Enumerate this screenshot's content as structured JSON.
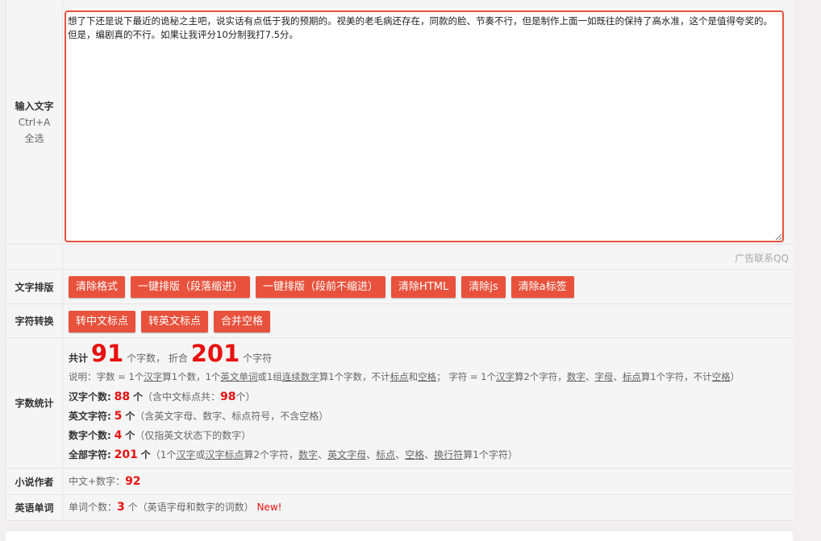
{
  "input": {
    "label": "输入文字",
    "hint": "Ctrl+A 全选",
    "text": "想了下还是说下最近的诡秘之主吧，说实话有点低于我的预期的。视美的老毛病还存在，同款的脸、节奏不行，但是制作上面一如既往的保持了高水准，这个是值得夸奖的。但是，编剧真的不行。如果让我评分10分制我打7.5分。",
    "ad": "广告联系QQ"
  },
  "layout_row": {
    "label": "文字排版",
    "buttons": [
      "清除格式",
      "一键排版（段落缩进）",
      "一键排版（段前不缩进）",
      "清除HTML",
      "清除js",
      "清除a标签"
    ]
  },
  "convert_row": {
    "label": "字符转换",
    "buttons": [
      "转中文标点",
      "转英文标点",
      "合并空格"
    ]
  },
  "stats": {
    "label": "字数统计",
    "total_prefix": "共计",
    "word_count": "91",
    "word_unit": "个字数，",
    "equiv": "折合",
    "char_count": "201",
    "char_unit": "个字符",
    "desc": {
      "p1": "说明：字数 = 1个",
      "u1": "汉字",
      "p2": "算1个数，1个",
      "u2": "英文单词",
      "p3": "或1组",
      "u3": "连续数字",
      "p4": "算1个字数，不计",
      "u4": "标点",
      "p5": "和",
      "u5": "空格",
      "p6": "；  字符 = 1个",
      "u6": "汉字",
      "p7": "算2个字符，",
      "u7": "数字",
      "p8": "、",
      "u8": "字母",
      "p9": "、",
      "u9": "标点",
      "p10": "算1个字符，不计",
      "u10": "空格",
      "p11": "）"
    },
    "hanzi_label": "汉字个数:",
    "hanzi_count": "88",
    "hanzi_unit": "个",
    "hanzi_note_a": "（含中文标点共：",
    "hanzi_punct": "98",
    "hanzi_note_b": "个）",
    "en_label": "英文字符:",
    "en_count": "5",
    "en_unit": "个",
    "en_note": "（含英文字母、数字、标点符号，不含空格）",
    "num_label": "数字个数:",
    "num_count": "4",
    "num_unit": "个",
    "num_note": "（仅指英文状态下的数字）",
    "all_label": "全部字符:",
    "all_count": "201",
    "all_unit": "个",
    "all_note": {
      "p1": "（1个",
      "u1": "汉字",
      "p2": "或",
      "u2": "汉字标点",
      "p3": "算2个字符，",
      "u3": "数字",
      "p4": "、",
      "u4": "英文字母",
      "p5": "、",
      "u5": "标点",
      "p6": "、",
      "u6": "空格",
      "p7": "、",
      "u7": "换行符",
      "p8": "算1个字符）"
    }
  },
  "novel": {
    "label": "小说作者",
    "text": "中文+数字：",
    "value": "92"
  },
  "english": {
    "label": "英语单词",
    "text": "单词个数：",
    "value": "3",
    "unit": "个",
    "note": "（英语字母和数字的词数）",
    "new": "New!"
  }
}
